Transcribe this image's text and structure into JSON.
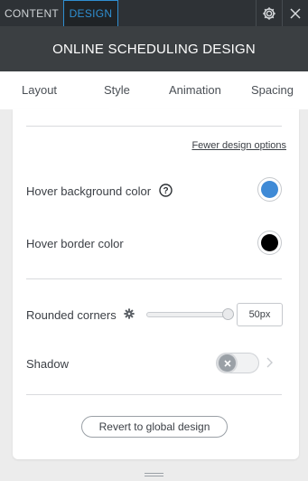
{
  "top_tabs": {
    "content": "CONTENT",
    "design": "DESIGN"
  },
  "title": "ONLINE SCHEDULING DESIGN",
  "sub_tabs": [
    "Layout",
    "Style",
    "Animation",
    "Spacing"
  ],
  "active_sub_tab": "Style",
  "panel": {
    "fewer_options_link": "Fewer design options",
    "hover_background": {
      "label": "Hover background color",
      "color": "#3f8ad6"
    },
    "hover_border": {
      "label": "Hover border color",
      "color": "#000000"
    },
    "rounded_corners": {
      "label": "Rounded corners",
      "value": "50px",
      "slider_fraction": 1.0
    },
    "shadow": {
      "label": "Shadow",
      "enabled": false
    },
    "revert_button": "Revert to global design"
  },
  "colors": {
    "accent": "#2f8fd1",
    "topbar": "#2e3236",
    "title_band": "#3b3f42"
  }
}
